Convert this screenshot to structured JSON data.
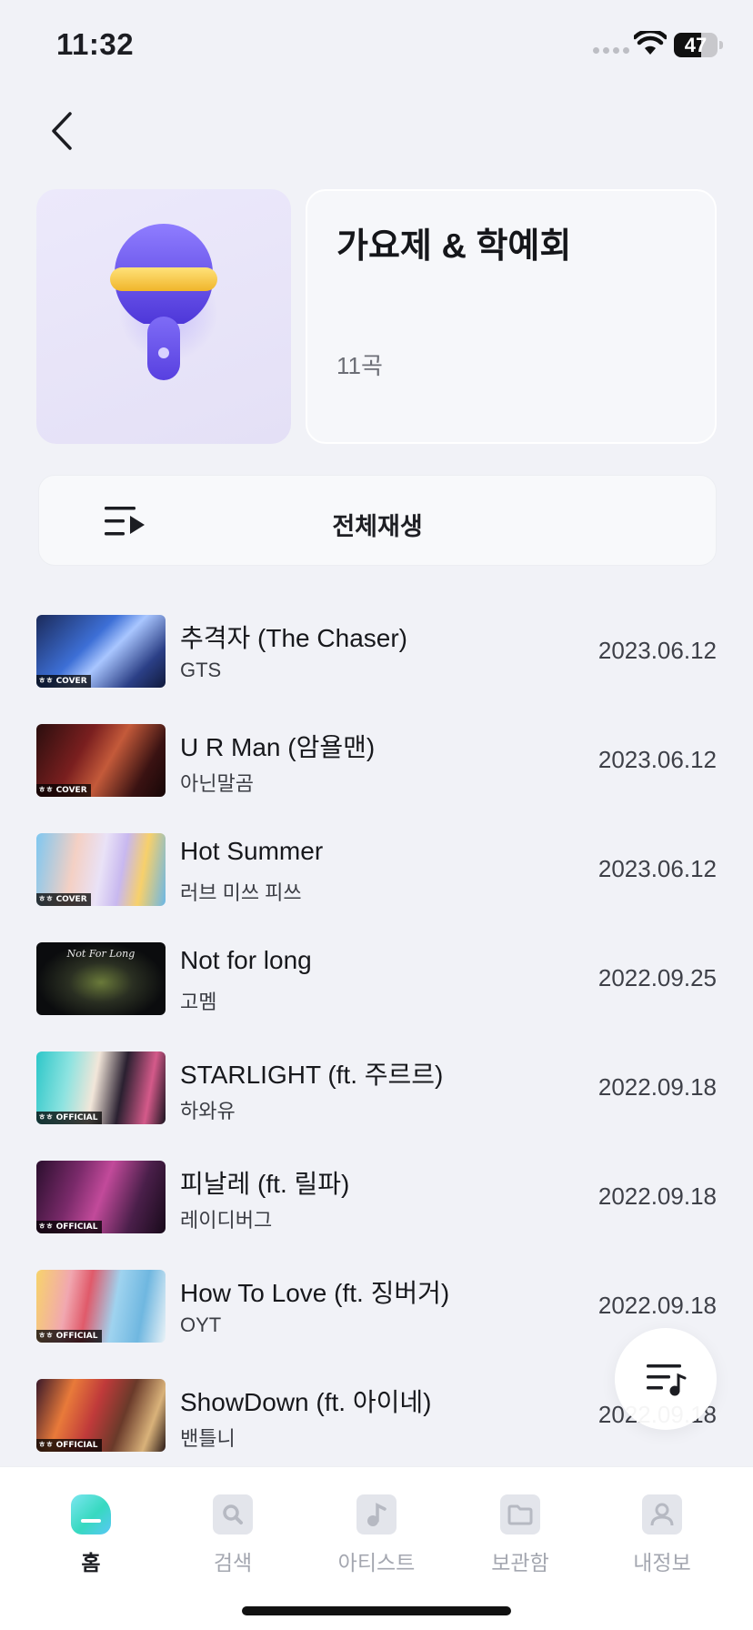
{
  "status_bar": {
    "time": "11:32",
    "battery": "47"
  },
  "playlist": {
    "title": "가요제 & 학예회",
    "count": "11곡"
  },
  "play_all_label": "전체재생",
  "tracks": [
    {
      "title": "추격자 (The Chaser)",
      "artist": "GTS",
      "date": "2023.06.12",
      "badge": "COVER"
    },
    {
      "title": "U R Man (암욜맨)",
      "artist": "아닌말곰",
      "date": "2023.06.12",
      "badge": "COVER"
    },
    {
      "title": "Hot Summer",
      "artist": "러브 미쓰 피쓰",
      "date": "2023.06.12",
      "badge": "COVER"
    },
    {
      "title": "Not for long",
      "artist": "고멤",
      "date": "2022.09.25",
      "badge": "Not For Long"
    },
    {
      "title": "STARLIGHT (ft. 주르르)",
      "artist": "하와유",
      "date": "2022.09.18",
      "badge": "OFFICIAL"
    },
    {
      "title": "피날레 (ft. 릴파)",
      "artist": "레이디버그",
      "date": "2022.09.18",
      "badge": "OFFICIAL"
    },
    {
      "title": "How To Love (ft. 징버거)",
      "artist": "OYT",
      "date": "2022.09.18",
      "badge": "OFFICIAL"
    },
    {
      "title": "ShowDown (ft. 아이네)",
      "artist": "밴틀니",
      "date": "2022.09.18",
      "badge": "OFFICIAL"
    }
  ],
  "tab_bar": [
    {
      "label": "홈",
      "icon": "home-icon",
      "active": true
    },
    {
      "label": "검색",
      "icon": "search-icon",
      "active": false
    },
    {
      "label": "아티스트",
      "icon": "music-note-icon",
      "active": false
    },
    {
      "label": "보관함",
      "icon": "folder-icon",
      "active": false
    },
    {
      "label": "내정보",
      "icon": "profile-icon",
      "active": false
    }
  ],
  "colors": {
    "background": "#f1f2f7",
    "accent_purple": "#6f5cf0",
    "accent_yellow": "#f4c93d",
    "home_tab_gradient": "#38e0d0"
  }
}
